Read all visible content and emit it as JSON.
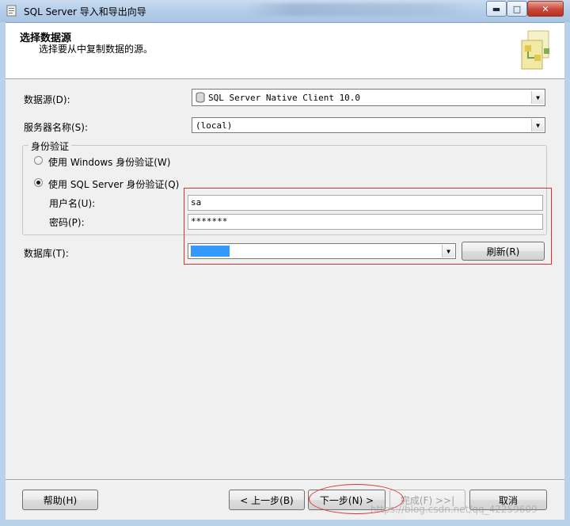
{
  "window": {
    "title": "SQL Server 导入和导出向导",
    "minimize_icon": "minimize-icon",
    "maximize_icon": "maximize-icon",
    "close_icon": "close-icon"
  },
  "header": {
    "title": "选择数据源",
    "subtitle": "选择要从中复制数据的源。"
  },
  "form": {
    "datasource_label": "数据源(D):",
    "datasource_value": "SQL Server Native Client 10.0",
    "server_label": "服务器名称(S):",
    "server_value": "(local)",
    "auth_group_label": "身份验证",
    "windows_auth_label": "使用 Windows 身份验证(W)",
    "sql_auth_label": "使用 SQL Server 身份验证(Q)",
    "selected_auth": "sql",
    "username_label": "用户名(U):",
    "username_value": "sa",
    "password_label": "密码(P):",
    "password_value": "*******",
    "database_label": "数据库(T):",
    "database_value": "",
    "refresh_label": "刷新(R)"
  },
  "footer": {
    "help_label": "帮助(H)",
    "back_label": "< 上一步(B)",
    "next_label": "下一步(N) >",
    "finish_label": "完成(F) >>|",
    "cancel_label": "取消"
  },
  "watermark": "https://blog.csdn.net/qq_42259609",
  "colors": {
    "annotation": "#e03030",
    "selection": "#3399ff"
  }
}
